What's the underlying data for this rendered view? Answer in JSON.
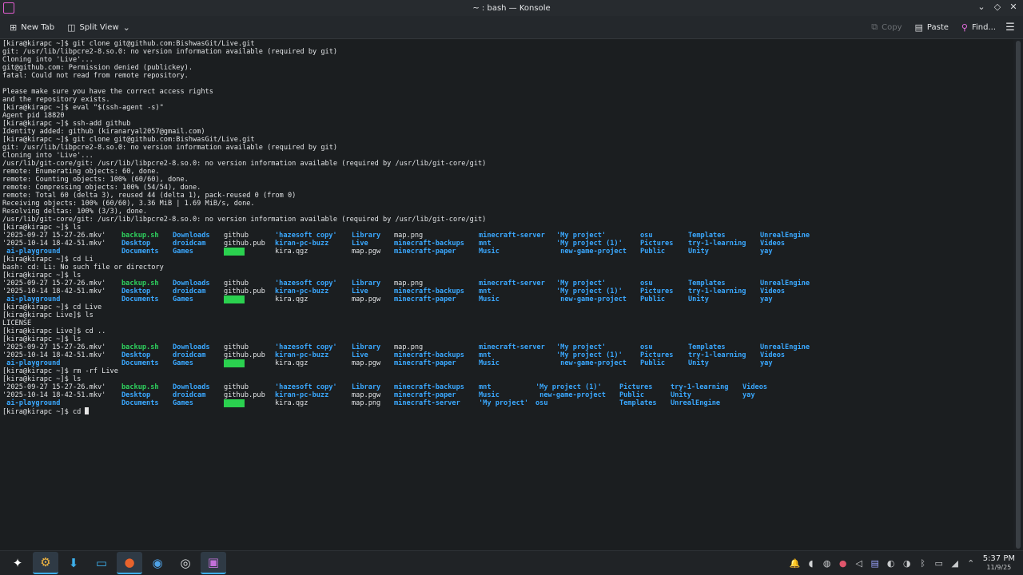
{
  "window": {
    "title": "~ : bash — Konsole"
  },
  "toolbar": {
    "new_tab": "New Tab",
    "split_view": "Split View",
    "copy": "Copy",
    "paste": "Paste",
    "find": "Find..."
  },
  "terminal": {
    "blocks": [
      {
        "lines": [
          "[kira@kirapc ~]$ git clone git@github.com:BishwasGit/Live.git",
          "git: /usr/lib/libpcre2-8.so.0: no version information available (required by git)",
          "Cloning into 'Live'...",
          "git@github.com: Permission denied (publickey).",
          "fatal: Could not read from remote repository.",
          "",
          "Please make sure you have the correct access rights",
          "and the repository exists.",
          "[kira@kirapc ~]$ eval \"$(ssh-agent -s)\"",
          "Agent pid 18820",
          "[kira@kirapc ~]$ ssh-add github",
          "Identity added: github (kiranaryal2057@gmail.com)",
          "[kira@kirapc ~]$ git clone git@github.com:BishwasGit/Live.git",
          "git: /usr/lib/libpcre2-8.so.0: no version information available (required by git)",
          "Cloning into 'Live'...",
          "/usr/lib/git-core/git: /usr/lib/libpcre2-8.so.0: no version information available (required by /usr/lib/git-core/git)",
          "remote: Enumerating objects: 60, done.",
          "remote: Counting objects: 100% (60/60), done.",
          "remote: Compressing objects: 100% (54/54), done.",
          "remote: Total 60 (delta 3), reused 44 (delta 1), pack-reused 0 (from 0)",
          "Receiving objects: 100% (60/60), 3.36 MiB | 1.69 MiB/s, done.",
          "Resolving deltas: 100% (3/3), done.",
          "/usr/lib/git-core/git: /usr/lib/libpcre2-8.so.0: no version information available (required by /usr/lib/git-core/git)",
          "[kira@kirapc ~]$ ls"
        ]
      },
      {
        "ls": [
          [
            [
              "'2025-09-27 15-27-26.mkv'",
              "p"
            ],
            [
              "backup.sh",
              "e"
            ],
            [
              "Downloads",
              "d"
            ],
            [
              "github",
              "p"
            ],
            [
              "'hazesoft copy'",
              "d"
            ],
            [
              "Library",
              "d"
            ],
            [
              "map.png",
              "p"
            ],
            [
              "minecraft-server",
              "d"
            ],
            [
              "'My project'",
              "d"
            ],
            [
              "osu",
              "d"
            ],
            [
              "Templates",
              "d"
            ],
            [
              "UnrealEngine",
              "d"
            ]
          ],
          [
            [
              "'2025-10-14 18-42-51.mkv'",
              "p"
            ],
            [
              "Desktop",
              "d"
            ],
            [
              "droidcam",
              "d"
            ],
            [
              "github.pub",
              "p"
            ],
            [
              "kiran-pc-buzz",
              "d"
            ],
            [
              "Live",
              "d"
            ],
            [
              "minecraft-backups",
              "d"
            ],
            [
              "mnt",
              "d"
            ],
            [
              "'My project (1)'",
              "d"
            ],
            [
              "Pictures",
              "d"
            ],
            [
              "try-1-learning",
              "d"
            ],
            [
              "Videos",
              "d"
            ]
          ],
          [
            [
              " ai-playground",
              "d"
            ],
            [
              "Documents",
              "d"
            ],
            [
              "Games",
              "d"
            ],
            [
              "icons",
              "h"
            ],
            [
              "kira.qgz",
              "p"
            ],
            [
              "map.pgw",
              "p"
            ],
            [
              "minecraft-paper",
              "d"
            ],
            [
              "Music",
              "d"
            ],
            [
              " new-game-project",
              "d"
            ],
            [
              "Public",
              "d"
            ],
            [
              "Unity",
              "d"
            ],
            [
              "yay",
              "d"
            ]
          ]
        ]
      },
      {
        "lines": [
          "[kira@kirapc ~]$ cd Li",
          "bash: cd: Li: No such file or directory",
          "[kira@kirapc ~]$ ls"
        ]
      },
      {
        "ls": [
          [
            [
              "'2025-09-27 15-27-26.mkv'",
              "p"
            ],
            [
              "backup.sh",
              "e"
            ],
            [
              "Downloads",
              "d"
            ],
            [
              "github",
              "p"
            ],
            [
              "'hazesoft copy'",
              "d"
            ],
            [
              "Library",
              "d"
            ],
            [
              "map.png",
              "p"
            ],
            [
              "minecraft-server",
              "d"
            ],
            [
              "'My project'",
              "d"
            ],
            [
              "osu",
              "d"
            ],
            [
              "Templates",
              "d"
            ],
            [
              "UnrealEngine",
              "d"
            ]
          ],
          [
            [
              "'2025-10-14 18-42-51.mkv'",
              "p"
            ],
            [
              "Desktop",
              "d"
            ],
            [
              "droidcam",
              "d"
            ],
            [
              "github.pub",
              "p"
            ],
            [
              "kiran-pc-buzz",
              "d"
            ],
            [
              "Live",
              "d"
            ],
            [
              "minecraft-backups",
              "d"
            ],
            [
              "mnt",
              "d"
            ],
            [
              "'My project (1)'",
              "d"
            ],
            [
              "Pictures",
              "d"
            ],
            [
              "try-1-learning",
              "d"
            ],
            [
              "Videos",
              "d"
            ]
          ],
          [
            [
              " ai-playground",
              "d"
            ],
            [
              "Documents",
              "d"
            ],
            [
              "Games",
              "d"
            ],
            [
              "icons",
              "h"
            ],
            [
              "kira.qgz",
              "p"
            ],
            [
              "map.pgw",
              "p"
            ],
            [
              "minecraft-paper",
              "d"
            ],
            [
              "Music",
              "d"
            ],
            [
              " new-game-project",
              "d"
            ],
            [
              "Public",
              "d"
            ],
            [
              "Unity",
              "d"
            ],
            [
              "yay",
              "d"
            ]
          ]
        ]
      },
      {
        "lines": [
          "[kira@kirapc ~]$ cd Live",
          "[kira@kirapc Live]$ ls",
          "LICENSE",
          "[kira@kirapc Live]$ cd ..",
          "[kira@kirapc ~]$ ls"
        ]
      },
      {
        "ls": [
          [
            [
              "'2025-09-27 15-27-26.mkv'",
              "p"
            ],
            [
              "backup.sh",
              "e"
            ],
            [
              "Downloads",
              "d"
            ],
            [
              "github",
              "p"
            ],
            [
              "'hazesoft copy'",
              "d"
            ],
            [
              "Library",
              "d"
            ],
            [
              "map.png",
              "p"
            ],
            [
              "minecraft-server",
              "d"
            ],
            [
              "'My project'",
              "d"
            ],
            [
              "osu",
              "d"
            ],
            [
              "Templates",
              "d"
            ],
            [
              "UnrealEngine",
              "d"
            ]
          ],
          [
            [
              "'2025-10-14 18-42-51.mkv'",
              "p"
            ],
            [
              "Desktop",
              "d"
            ],
            [
              "droidcam",
              "d"
            ],
            [
              "github.pub",
              "p"
            ],
            [
              "kiran-pc-buzz",
              "d"
            ],
            [
              "Live",
              "d"
            ],
            [
              "minecraft-backups",
              "d"
            ],
            [
              "mnt",
              "d"
            ],
            [
              "'My project (1)'",
              "d"
            ],
            [
              "Pictures",
              "d"
            ],
            [
              "try-1-learning",
              "d"
            ],
            [
              "Videos",
              "d"
            ]
          ],
          [
            [
              " ai-playground",
              "d"
            ],
            [
              "Documents",
              "d"
            ],
            [
              "Games",
              "d"
            ],
            [
              "icons",
              "h"
            ],
            [
              "kira.qgz",
              "p"
            ],
            [
              "map.pgw",
              "p"
            ],
            [
              "minecraft-paper",
              "d"
            ],
            [
              "Music",
              "d"
            ],
            [
              " new-game-project",
              "d"
            ],
            [
              "Public",
              "d"
            ],
            [
              "Unity",
              "d"
            ],
            [
              "yay",
              "d"
            ]
          ]
        ]
      },
      {
        "lines": [
          "[kira@kirapc ~]$ rm -rf Live",
          "[kira@kirapc ~]$ ls"
        ]
      },
      {
        "ls": [
          [
            [
              "'2025-09-27 15-27-26.mkv'",
              "p"
            ],
            [
              "backup.sh",
              "e"
            ],
            [
              "Downloads",
              "d"
            ],
            [
              "github",
              "p"
            ],
            [
              "'hazesoft copy'",
              "d"
            ],
            [
              "Library",
              "d"
            ],
            [
              "minecraft-backups",
              "d"
            ],
            [
              "mnt",
              "d"
            ],
            [
              "'My project (1)'",
              "d"
            ],
            [
              "Pictures",
              "d"
            ],
            [
              "try-1-learning",
              "d"
            ],
            [
              "Videos",
              "d"
            ]
          ],
          [
            [
              "'2025-10-14 18-42-51.mkv'",
              "p"
            ],
            [
              "Desktop",
              "d"
            ],
            [
              "droidcam",
              "d"
            ],
            [
              "github.pub",
              "p"
            ],
            [
              "kiran-pc-buzz",
              "d"
            ],
            [
              "map.pgw",
              "p"
            ],
            [
              "minecraft-paper",
              "d"
            ],
            [
              "Music",
              "d"
            ],
            [
              " new-game-project",
              "d"
            ],
            [
              "Public",
              "d"
            ],
            [
              "Unity",
              "d"
            ],
            [
              "yay",
              "d"
            ]
          ],
          [
            [
              " ai-playground",
              "d"
            ],
            [
              "Documents",
              "d"
            ],
            [
              "Games",
              "d"
            ],
            [
              "icons",
              "h"
            ],
            [
              "kira.qgz",
              "p"
            ],
            [
              "map.png",
              "p"
            ],
            [
              "minecraft-server",
              "d"
            ],
            [
              "'My project'",
              "d"
            ],
            [
              "osu",
              "d"
            ],
            [
              "Templates",
              "d"
            ],
            [
              "UnrealEngine",
              "d"
            ]
          ]
        ]
      }
    ],
    "prompt": "[kira@kirapc ~]$ cd "
  },
  "taskbar": {
    "apps": [
      {
        "name": "app-launcher-icon",
        "glyph": "✦",
        "color": "#ffffff"
      },
      {
        "name": "system-settings-icon",
        "glyph": "⚙",
        "color": "#f2b640"
      },
      {
        "name": "discover-icon",
        "glyph": "⬇",
        "color": "#3daee9"
      },
      {
        "name": "file-manager-icon",
        "glyph": "▭",
        "color": "#3daee9"
      },
      {
        "name": "firefox-icon",
        "glyph": "●",
        "color": "#e8632c"
      },
      {
        "name": "game-controller-icon",
        "glyph": "◉",
        "color": "#4fa3e8"
      },
      {
        "name": "obs-icon",
        "glyph": "◎",
        "color": "#dfe1e3"
      },
      {
        "name": "konsole-icon",
        "glyph": "▣",
        "color": "#c270d9"
      }
    ],
    "tray": [
      {
        "name": "notification-bell-icon",
        "glyph": "🔔",
        "color": "#f0c040"
      },
      {
        "name": "discord-icon",
        "glyph": "◖",
        "color": "#d0d2d4"
      },
      {
        "name": "steam-icon",
        "glyph": "◍",
        "color": "#d0d2d4"
      },
      {
        "name": "record-icon",
        "glyph": "●",
        "color": "#e0566c"
      },
      {
        "name": "volume-icon",
        "glyph": "◁",
        "color": "#d0d2d4"
      },
      {
        "name": "clipboard-icon",
        "glyph": "▤",
        "color": "#9aa3ff"
      },
      {
        "name": "theme-icon",
        "glyph": "◐",
        "color": "#c8cacc"
      },
      {
        "name": "microphone-icon",
        "glyph": "◑",
        "color": "#c8cacc"
      },
      {
        "name": "bluetooth-icon",
        "glyph": "ᛒ",
        "color": "#c8cacc"
      },
      {
        "name": "display-icon",
        "glyph": "▭",
        "color": "#c8cacc"
      },
      {
        "name": "network-icon",
        "glyph": "◢",
        "color": "#c8cacc"
      },
      {
        "name": "tray-expand-icon",
        "glyph": "⌃",
        "color": "#c8cacc"
      }
    ],
    "time": "5:37 PM",
    "date": "11/9/25"
  }
}
